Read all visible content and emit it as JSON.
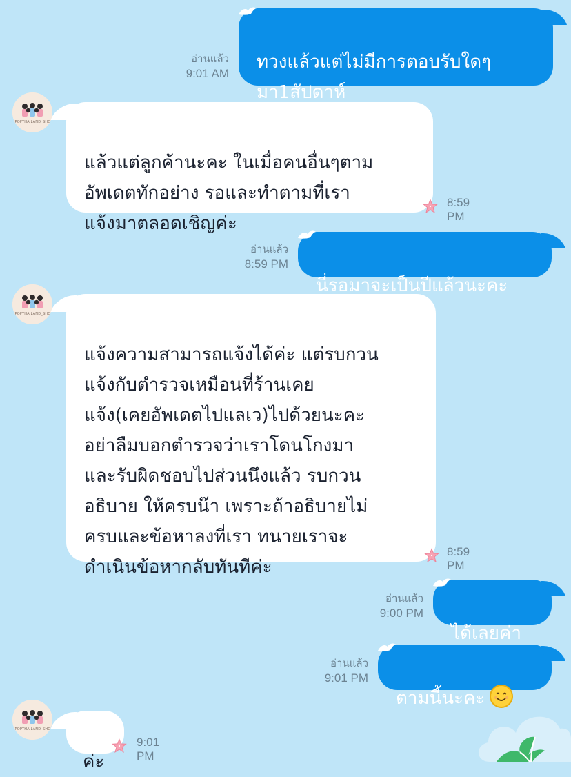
{
  "colors": {
    "background": "#bfe5f8",
    "outgoing_bubble": "#0b8fe8",
    "incoming_bubble": "#ffffff",
    "meta_text": "#6c8392"
  },
  "avatar": {
    "caption": "KPOPTHAILAND_SHOP"
  },
  "messages": [
    {
      "direction": "out",
      "text": "ทวงแล้วแต่ไม่มีการตอบรับใดๆ\nมา1สัปดาห์",
      "read": "อ่านแล้ว",
      "time": "9:01 AM"
    },
    {
      "direction": "in",
      "text": "แล้วแต่ลูกค้านะคะ ในเมื่อคนอื่นๆตาม\nอัพเดตทักอย่าง รอและทำตามที่เรา\nแจ้งมาตลอดเชิญค่ะ",
      "time": "8:59 PM",
      "icon": "starfish-icon"
    },
    {
      "direction": "out",
      "text": "นี่รอมาจะเป็นปีแล้วนะคะ",
      "read": "อ่านแล้ว",
      "time": "8:59 PM"
    },
    {
      "direction": "in",
      "text": "แจ้งความสามารถแจ้งได้ค่ะ แต่รบกวน\nแจ้งกับตำรวจเหมือนที่ร้านเคย\nแจ้ง(เคยอัพเดตไปแลเว)ไปด้วยนะคะ\nอย่าลืมบอกตำรวจว่าเราโดนโกงมา\nและรับผิดชอบไปส่วนนึงแล้ว  รบกวน\nอธิบาย ให้ครบน๊า เพราะถ้าอธิบายไม่\nครบและข้อหาลงที่เรา ทนายเราจะ\nดำเนินข้อหากลับทันทีค่ะ",
      "time": "8:59 PM",
      "icon": "starfish-icon"
    },
    {
      "direction": "out",
      "text": "ได้เลยค่า",
      "read": "อ่านแล้ว",
      "time": "9:00 PM"
    },
    {
      "direction": "out",
      "text": "ตามนี้นะคะ",
      "emoji": "smiling-face-icon",
      "read": "อ่านแล้ว",
      "time": "9:01 PM"
    },
    {
      "direction": "in",
      "text": "ค่ะ",
      "time": "9:01 PM",
      "icon": "starfish-icon"
    }
  ]
}
